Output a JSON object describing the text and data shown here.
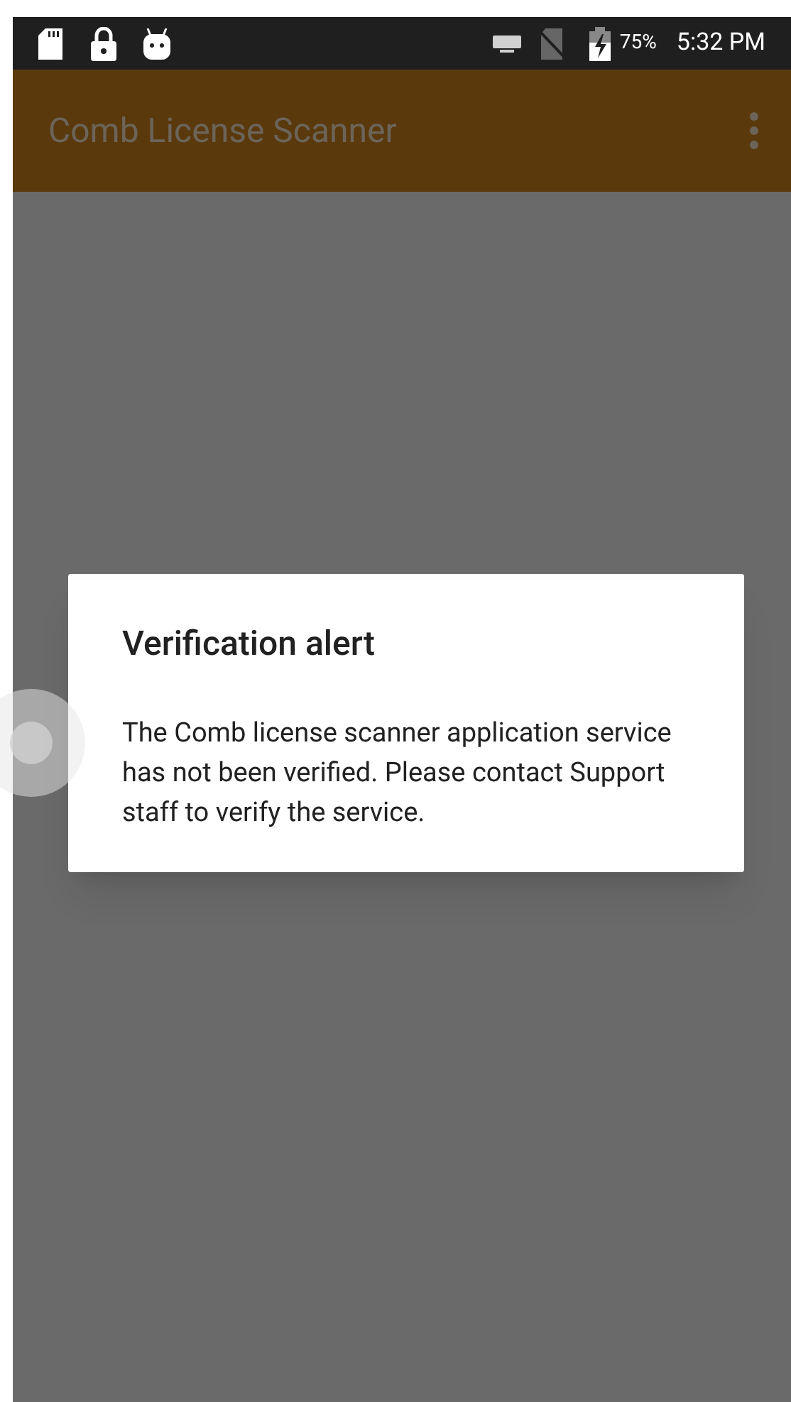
{
  "status_bar": {
    "battery": "75%",
    "time": "5:32 PM"
  },
  "app_bar": {
    "title": "Comb License Scanner"
  },
  "dialog": {
    "title": "Verification alert",
    "message": "The Comb license scanner application service has not been verified. Please contact Support staff to verify the service."
  }
}
